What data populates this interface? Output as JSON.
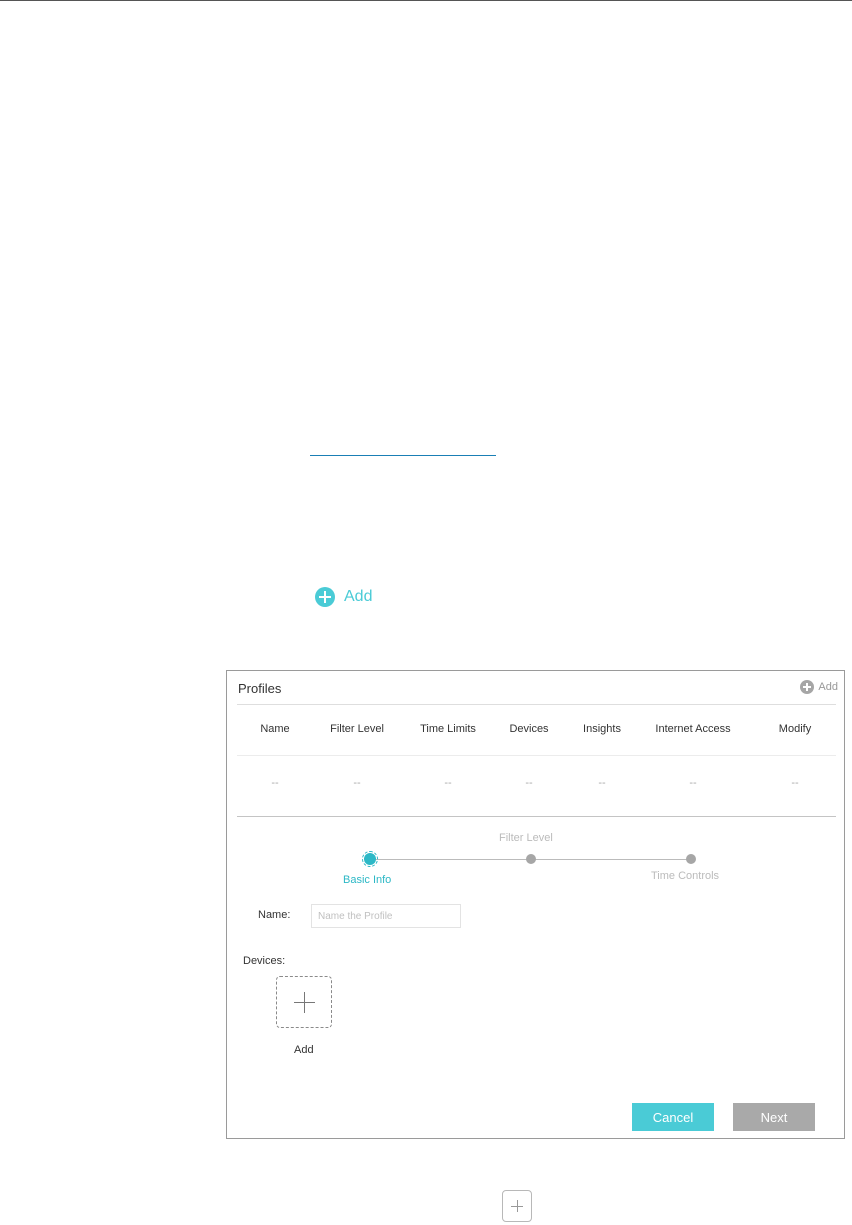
{
  "add_link": {
    "label": "Add",
    "icon": "plus-circle-icon",
    "color": "#4acbd6"
  },
  "profiles": {
    "title": "Profiles",
    "add_label": "Add",
    "columns": [
      "Name",
      "Filter Level",
      "Time Limits",
      "Devices",
      "Insights",
      "Internet Access",
      "Modify"
    ],
    "row": [
      "--",
      "--",
      "--",
      "--",
      "--",
      "--",
      "--"
    ]
  },
  "stepper": {
    "steps": [
      {
        "label": "Basic Info",
        "state": "active"
      },
      {
        "label": "Filter Level",
        "state": "pending"
      },
      {
        "label": "Time Controls",
        "state": "pending"
      }
    ]
  },
  "form": {
    "name_label": "Name:",
    "name_placeholder": "Name the Profile",
    "name_value": "",
    "devices_label": "Devices:",
    "add_device_label": "Add"
  },
  "buttons": {
    "cancel": "Cancel",
    "next": "Next"
  },
  "colors": {
    "accent": "#4acbd6",
    "disabled": "#a9a9a9"
  }
}
